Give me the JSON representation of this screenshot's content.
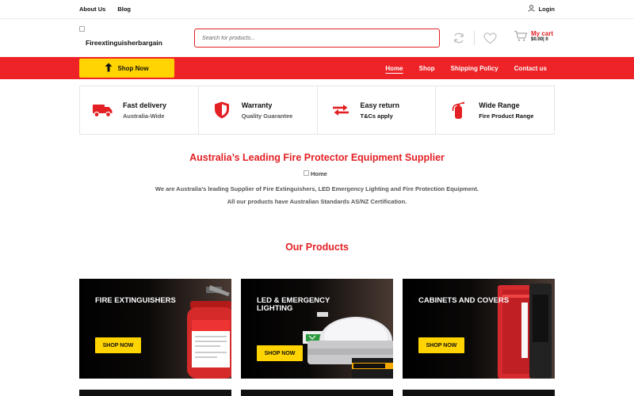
{
  "topbar": {
    "links": [
      "About Us",
      "Blog"
    ],
    "login_label": "Login"
  },
  "header": {
    "logo_alt": "Fireextinguisherbargain",
    "search_placeholder": "Search for products...",
    "cart": {
      "label": "My cart",
      "amount": "$0.00| 0"
    }
  },
  "navbar": {
    "shop_now_label": "Shop Now",
    "menu": [
      {
        "label": "Home",
        "active": true
      },
      {
        "label": "Shop",
        "active": false
      },
      {
        "label": "Shipping Policy",
        "active": false
      },
      {
        "label": "Contact us",
        "active": false
      }
    ]
  },
  "features": [
    {
      "icon": "truck-icon",
      "title": "Fast delivery",
      "subtitle": "Australia-Wide"
    },
    {
      "icon": "shield-icon",
      "title": "Warranty",
      "subtitle": "Quality Guarantee"
    },
    {
      "icon": "exchange-arrows-icon",
      "title": "Easy return",
      "subtitle": "T&Cs apply"
    },
    {
      "icon": "fire-extinguisher-icon",
      "title": "Wide Range",
      "subtitle": "Fire Product Range"
    }
  ],
  "intro": {
    "headline": "Australia’s Leading Fire Protector Equipment Supplier",
    "image_alt": "Home",
    "line1": "We are Australia’s leading Supplier of Fire Extinguishers, LED Emergency Lighting and Fire Protection Equipment.",
    "line2": "All our products have Australian Standards AS/NZ Certification."
  },
  "products": {
    "heading": "Our Products",
    "cards": [
      {
        "title_line1": "FIRE EXTINGUISHERS",
        "title_line2": "",
        "button": "SHOP NOW"
      },
      {
        "title_line1": "LED & EMERGENCY",
        "title_line2": "LIGHTING",
        "button": "SHOP NOW"
      },
      {
        "title_line1": "CABINETS AND COVERS",
        "title_line2": "",
        "button": "SHOP NOW"
      }
    ]
  },
  "colors": {
    "accent_red": "#ed2327",
    "accent_yellow": "#ffd400"
  }
}
